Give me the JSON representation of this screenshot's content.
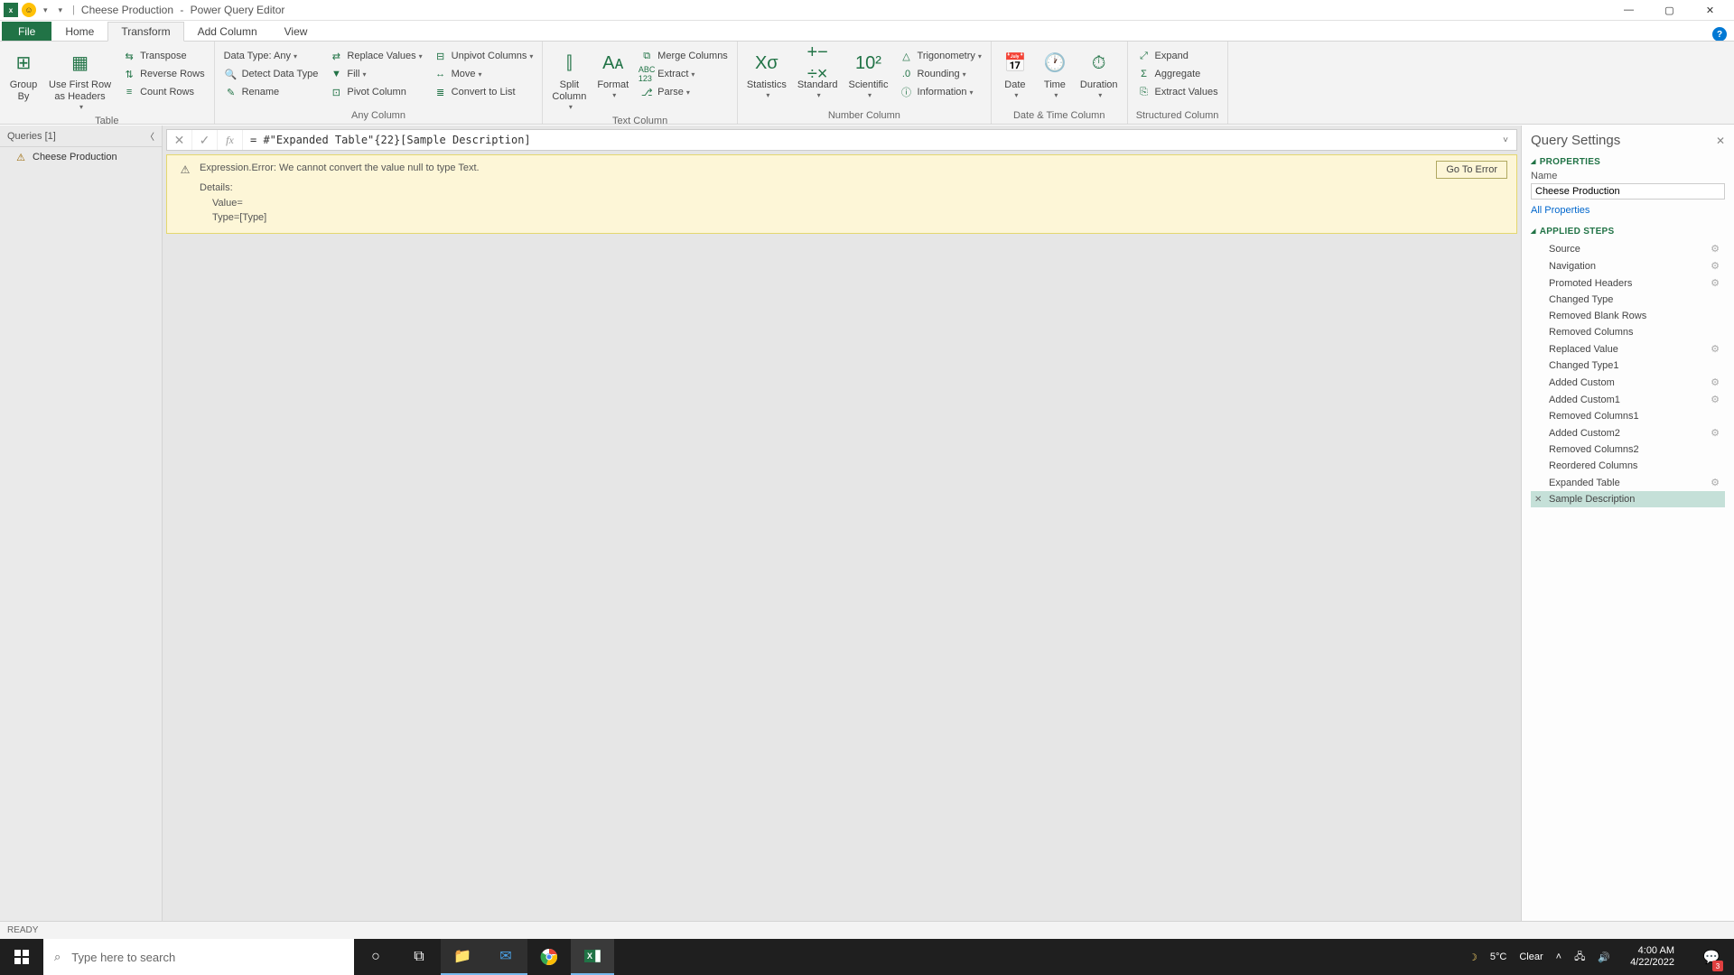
{
  "title": {
    "doc": "Cheese Production",
    "app": "Power Query Editor"
  },
  "tabs": {
    "file": "File",
    "home": "Home",
    "transform": "Transform",
    "add": "Add Column",
    "view": "View"
  },
  "ribbon": {
    "table": {
      "group_by": "Group\nBy",
      "first_row": "Use First Row\nas Headers",
      "transpose": "Transpose",
      "reverse": "Reverse Rows",
      "count": "Count Rows",
      "label": "Table"
    },
    "any": {
      "datatype": "Data Type: Any",
      "detect": "Detect Data Type",
      "rename": "Rename",
      "replace": "Replace Values",
      "fill": "Fill",
      "pivot": "Pivot Column",
      "unpivot": "Unpivot Columns",
      "move": "Move",
      "convert": "Convert to List",
      "label": "Any Column"
    },
    "text": {
      "split": "Split\nColumn",
      "format": "Format",
      "merge": "Merge Columns",
      "extract": "Extract",
      "parse": "Parse",
      "label": "Text Column"
    },
    "num": {
      "stats": "Statistics",
      "standard": "Standard",
      "scientific": "Scientific",
      "trig": "Trigonometry",
      "round": "Rounding",
      "info": "Information",
      "label": "Number Column"
    },
    "dt": {
      "date": "Date",
      "time": "Time",
      "duration": "Duration",
      "label": "Date & Time Column"
    },
    "struct": {
      "expand": "Expand",
      "aggregate": "Aggregate",
      "extract": "Extract Values",
      "label": "Structured Column"
    }
  },
  "queries": {
    "header": "Queries [1]",
    "item": "Cheese Production"
  },
  "formula": "= #\"Expanded Table\"{22}[Sample Description]",
  "error": {
    "title": "Expression.Error: We cannot convert the value null to type Text.",
    "details": "Details:",
    "value": "Value=",
    "type": "Type=[Type]",
    "goto": "Go To Error"
  },
  "settings": {
    "title": "Query Settings",
    "props": "PROPERTIES",
    "name_label": "Name",
    "name_value": "Cheese Production",
    "all_props": "All Properties",
    "applied": "APPLIED STEPS",
    "steps": [
      {
        "label": "Source",
        "gear": true
      },
      {
        "label": "Navigation",
        "gear": true
      },
      {
        "label": "Promoted Headers",
        "gear": true
      },
      {
        "label": "Changed Type",
        "gear": false
      },
      {
        "label": "Removed Blank Rows",
        "gear": false
      },
      {
        "label": "Removed Columns",
        "gear": false
      },
      {
        "label": "Replaced Value",
        "gear": true
      },
      {
        "label": "Changed Type1",
        "gear": false
      },
      {
        "label": "Added Custom",
        "gear": true
      },
      {
        "label": "Added Custom1",
        "gear": true
      },
      {
        "label": "Removed Columns1",
        "gear": false
      },
      {
        "label": "Added Custom2",
        "gear": true
      },
      {
        "label": "Removed Columns2",
        "gear": false
      },
      {
        "label": "Reordered Columns",
        "gear": false
      },
      {
        "label": "Expanded Table",
        "gear": true
      },
      {
        "label": "Sample Description",
        "gear": false,
        "selected": true,
        "x": true
      }
    ]
  },
  "status": "READY",
  "taskbar": {
    "search": "Type here to search",
    "weather_temp": "5°C",
    "weather_cond": "Clear",
    "time": "4:00 AM",
    "date": "4/22/2022",
    "notif_count": "3"
  }
}
